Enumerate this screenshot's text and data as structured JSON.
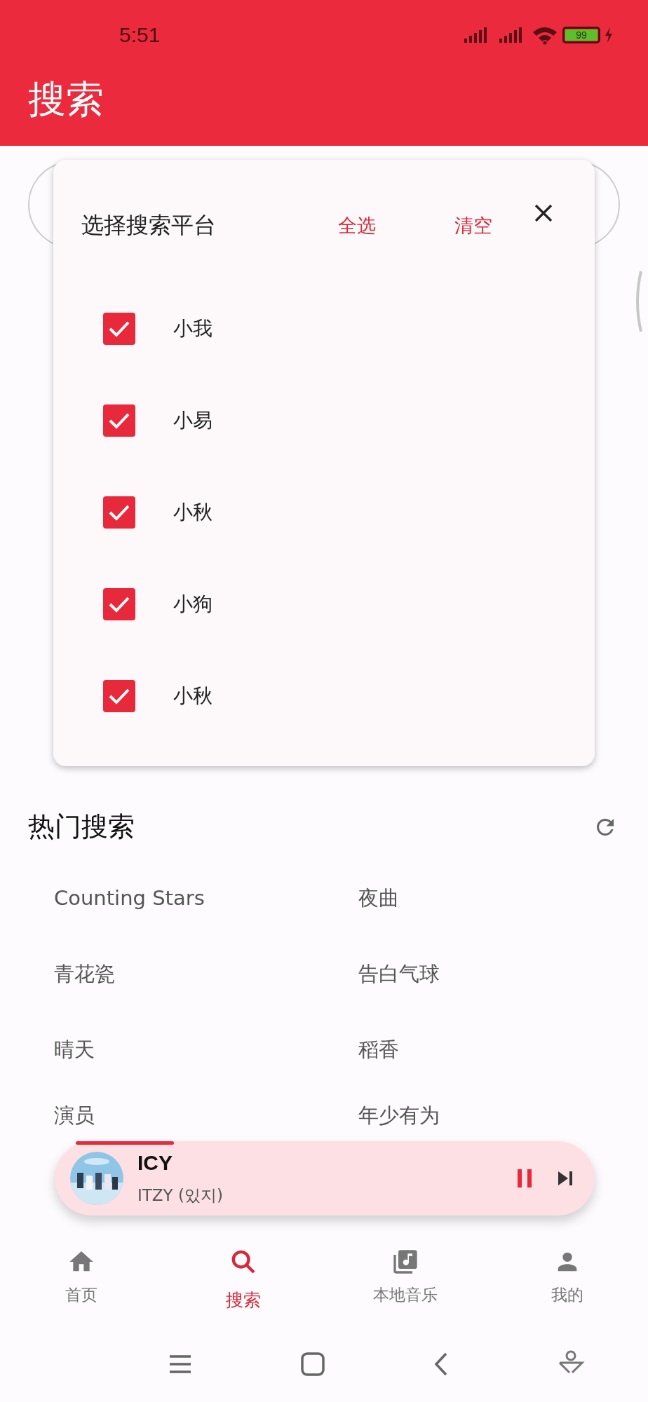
{
  "status_bar": {
    "time": "5:51",
    "battery": "99"
  },
  "header": {
    "title": "搜索"
  },
  "platform_dialog": {
    "title": "选择搜索平台",
    "select_all": "全选",
    "clear": "清空",
    "platforms": [
      {
        "label": "小我",
        "checked": true
      },
      {
        "label": "小易",
        "checked": true
      },
      {
        "label": "小秋",
        "checked": true
      },
      {
        "label": "小狗",
        "checked": true
      },
      {
        "label": "小秋",
        "checked": true
      }
    ]
  },
  "hot_search": {
    "title": "热门搜索",
    "items": [
      "Counting Stars",
      "夜曲",
      "青花瓷",
      "告白气球",
      "晴天",
      "稻香",
      "演员",
      "年少有为"
    ]
  },
  "mini_player": {
    "title": "ICY",
    "artist": "ITZY (있지)",
    "playing": true
  },
  "bottom_nav": [
    {
      "label": "首页",
      "kind": "home",
      "selected": false
    },
    {
      "label": "搜索",
      "kind": "search",
      "selected": true
    },
    {
      "label": "本地音乐",
      "kind": "library",
      "selected": false
    },
    {
      "label": "我的",
      "kind": "person",
      "selected": false
    }
  ]
}
